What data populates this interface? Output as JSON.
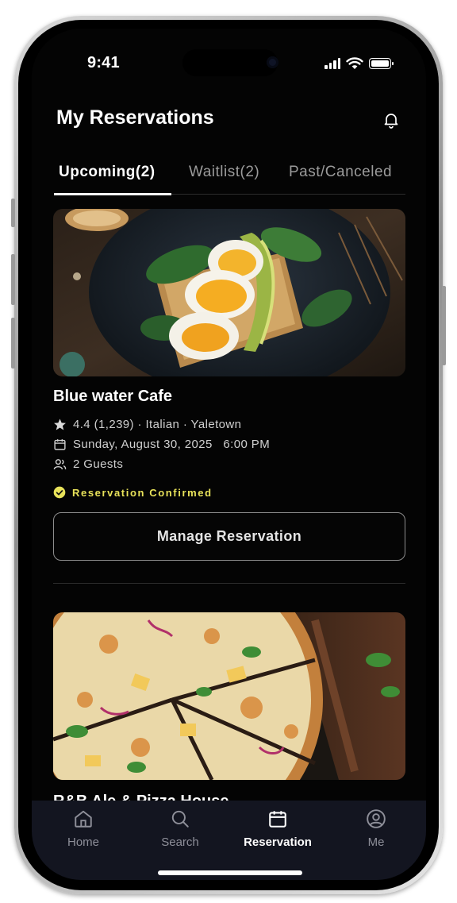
{
  "status_bar": {
    "time": "9:41"
  },
  "header": {
    "title": "My Reservations"
  },
  "tabs": [
    {
      "label": "Upcoming(2)",
      "active": true
    },
    {
      "label": "Waitlist(2)",
      "active": false
    },
    {
      "label": "Past/Canceled",
      "active": false
    }
  ],
  "reservations": [
    {
      "name": "Blue water Cafe",
      "rating_line": "4.4 (1,239) · Italian · Yaletown",
      "date_line": "Sunday, August 30, 2025   6:00 PM",
      "guests": "2 Guests",
      "status": "Reservation Confirmed",
      "action_label": "Manage Reservation",
      "image_icon": "egg-toast-photo"
    },
    {
      "name": "R&B Ale & Pizza House",
      "image_icon": "pizza-photo"
    }
  ],
  "bottom_nav": [
    {
      "label": "Home",
      "icon": "home-icon",
      "active": false
    },
    {
      "label": "Search",
      "icon": "search-icon",
      "active": false
    },
    {
      "label": "Reservation",
      "icon": "calendar-icon",
      "active": true
    },
    {
      "label": "Me",
      "icon": "user-icon",
      "active": false
    }
  ],
  "colors": {
    "background": "#040404",
    "accent_confirmed": "#e8e25a",
    "tabbar": "#131520"
  }
}
